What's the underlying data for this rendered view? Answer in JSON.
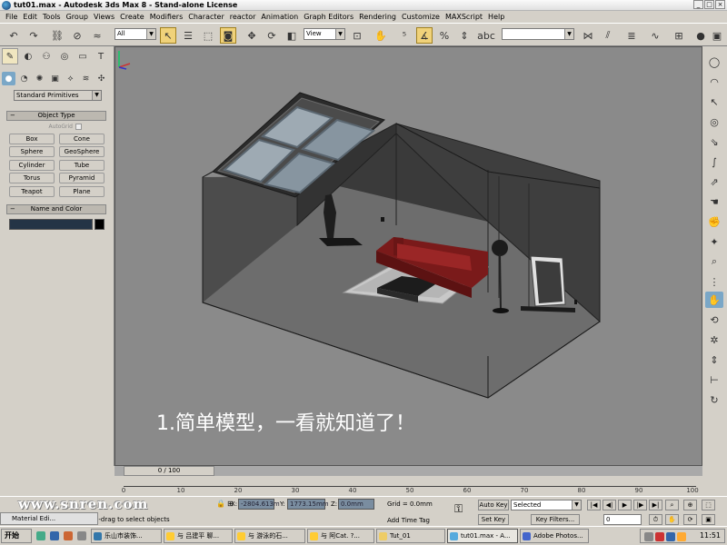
{
  "window": {
    "title": "tut01.max - Autodesk 3ds Max 8  - Stand-alone License",
    "min": "_",
    "max": "□",
    "close": "×"
  },
  "menu": [
    "File",
    "Edit",
    "Tools",
    "Group",
    "Views",
    "Create",
    "Modifiers",
    "Character",
    "reactor",
    "Animation",
    "Graph Editors",
    "Rendering",
    "Customize",
    "MAXScript",
    "Help"
  ],
  "toolbar": {
    "selection_filter": "All",
    "ref_coord": "View",
    "named_sets": ""
  },
  "command_panel": {
    "category": "Standard Primitives",
    "object_type_title": "Object Type",
    "autogrid_label": "AutoGrid",
    "buttons": [
      "Box",
      "Cone",
      "Sphere",
      "GeoSphere",
      "Cylinder",
      "Tube",
      "Torus",
      "Pyramid",
      "Teapot",
      "Plane"
    ],
    "name_color_title": "Name and Color"
  },
  "viewport": {
    "caption_number": "1",
    "caption_text": ".简单模型，一看就知道了！"
  },
  "timeline": {
    "slider_label": "0 / 100",
    "ticks": [
      "0",
      "10",
      "20",
      "30",
      "40",
      "50",
      "60",
      "70",
      "80",
      "90",
      "100"
    ]
  },
  "status": {
    "watermark": "www.snren.com",
    "prompt": "Click-and-drag to select objects",
    "x_label": "X:",
    "x_value": "-2804.613m",
    "y_label": "Y:",
    "y_value": "1773.15mm",
    "z_label": "Z:",
    "z_value": "0.0mm",
    "grid": "Grid = 0.0mm",
    "add_time_tag": "Add Time Tag",
    "auto_key": "Auto Key",
    "set_key": "Set Key",
    "key_mode": "Selected",
    "key_filters": "Key Filters...",
    "frame": "0",
    "material_editor": "Material Edi..."
  },
  "taskbar": {
    "start": "开始",
    "tasks": [
      "乐山市装饰...",
      "与 吕建平 聊...",
      "与 游泳的石...",
      "与 阿Cat. ?...",
      "Tut_01",
      "tut01.max - A...",
      "Adobe Photos..."
    ],
    "clock": "11:51"
  },
  "colors": {
    "viewport_bg": "#8a8a8a",
    "active_tab": "#7aa7c7",
    "name_field": "#243446",
    "sofa": "#8c1d1d"
  }
}
